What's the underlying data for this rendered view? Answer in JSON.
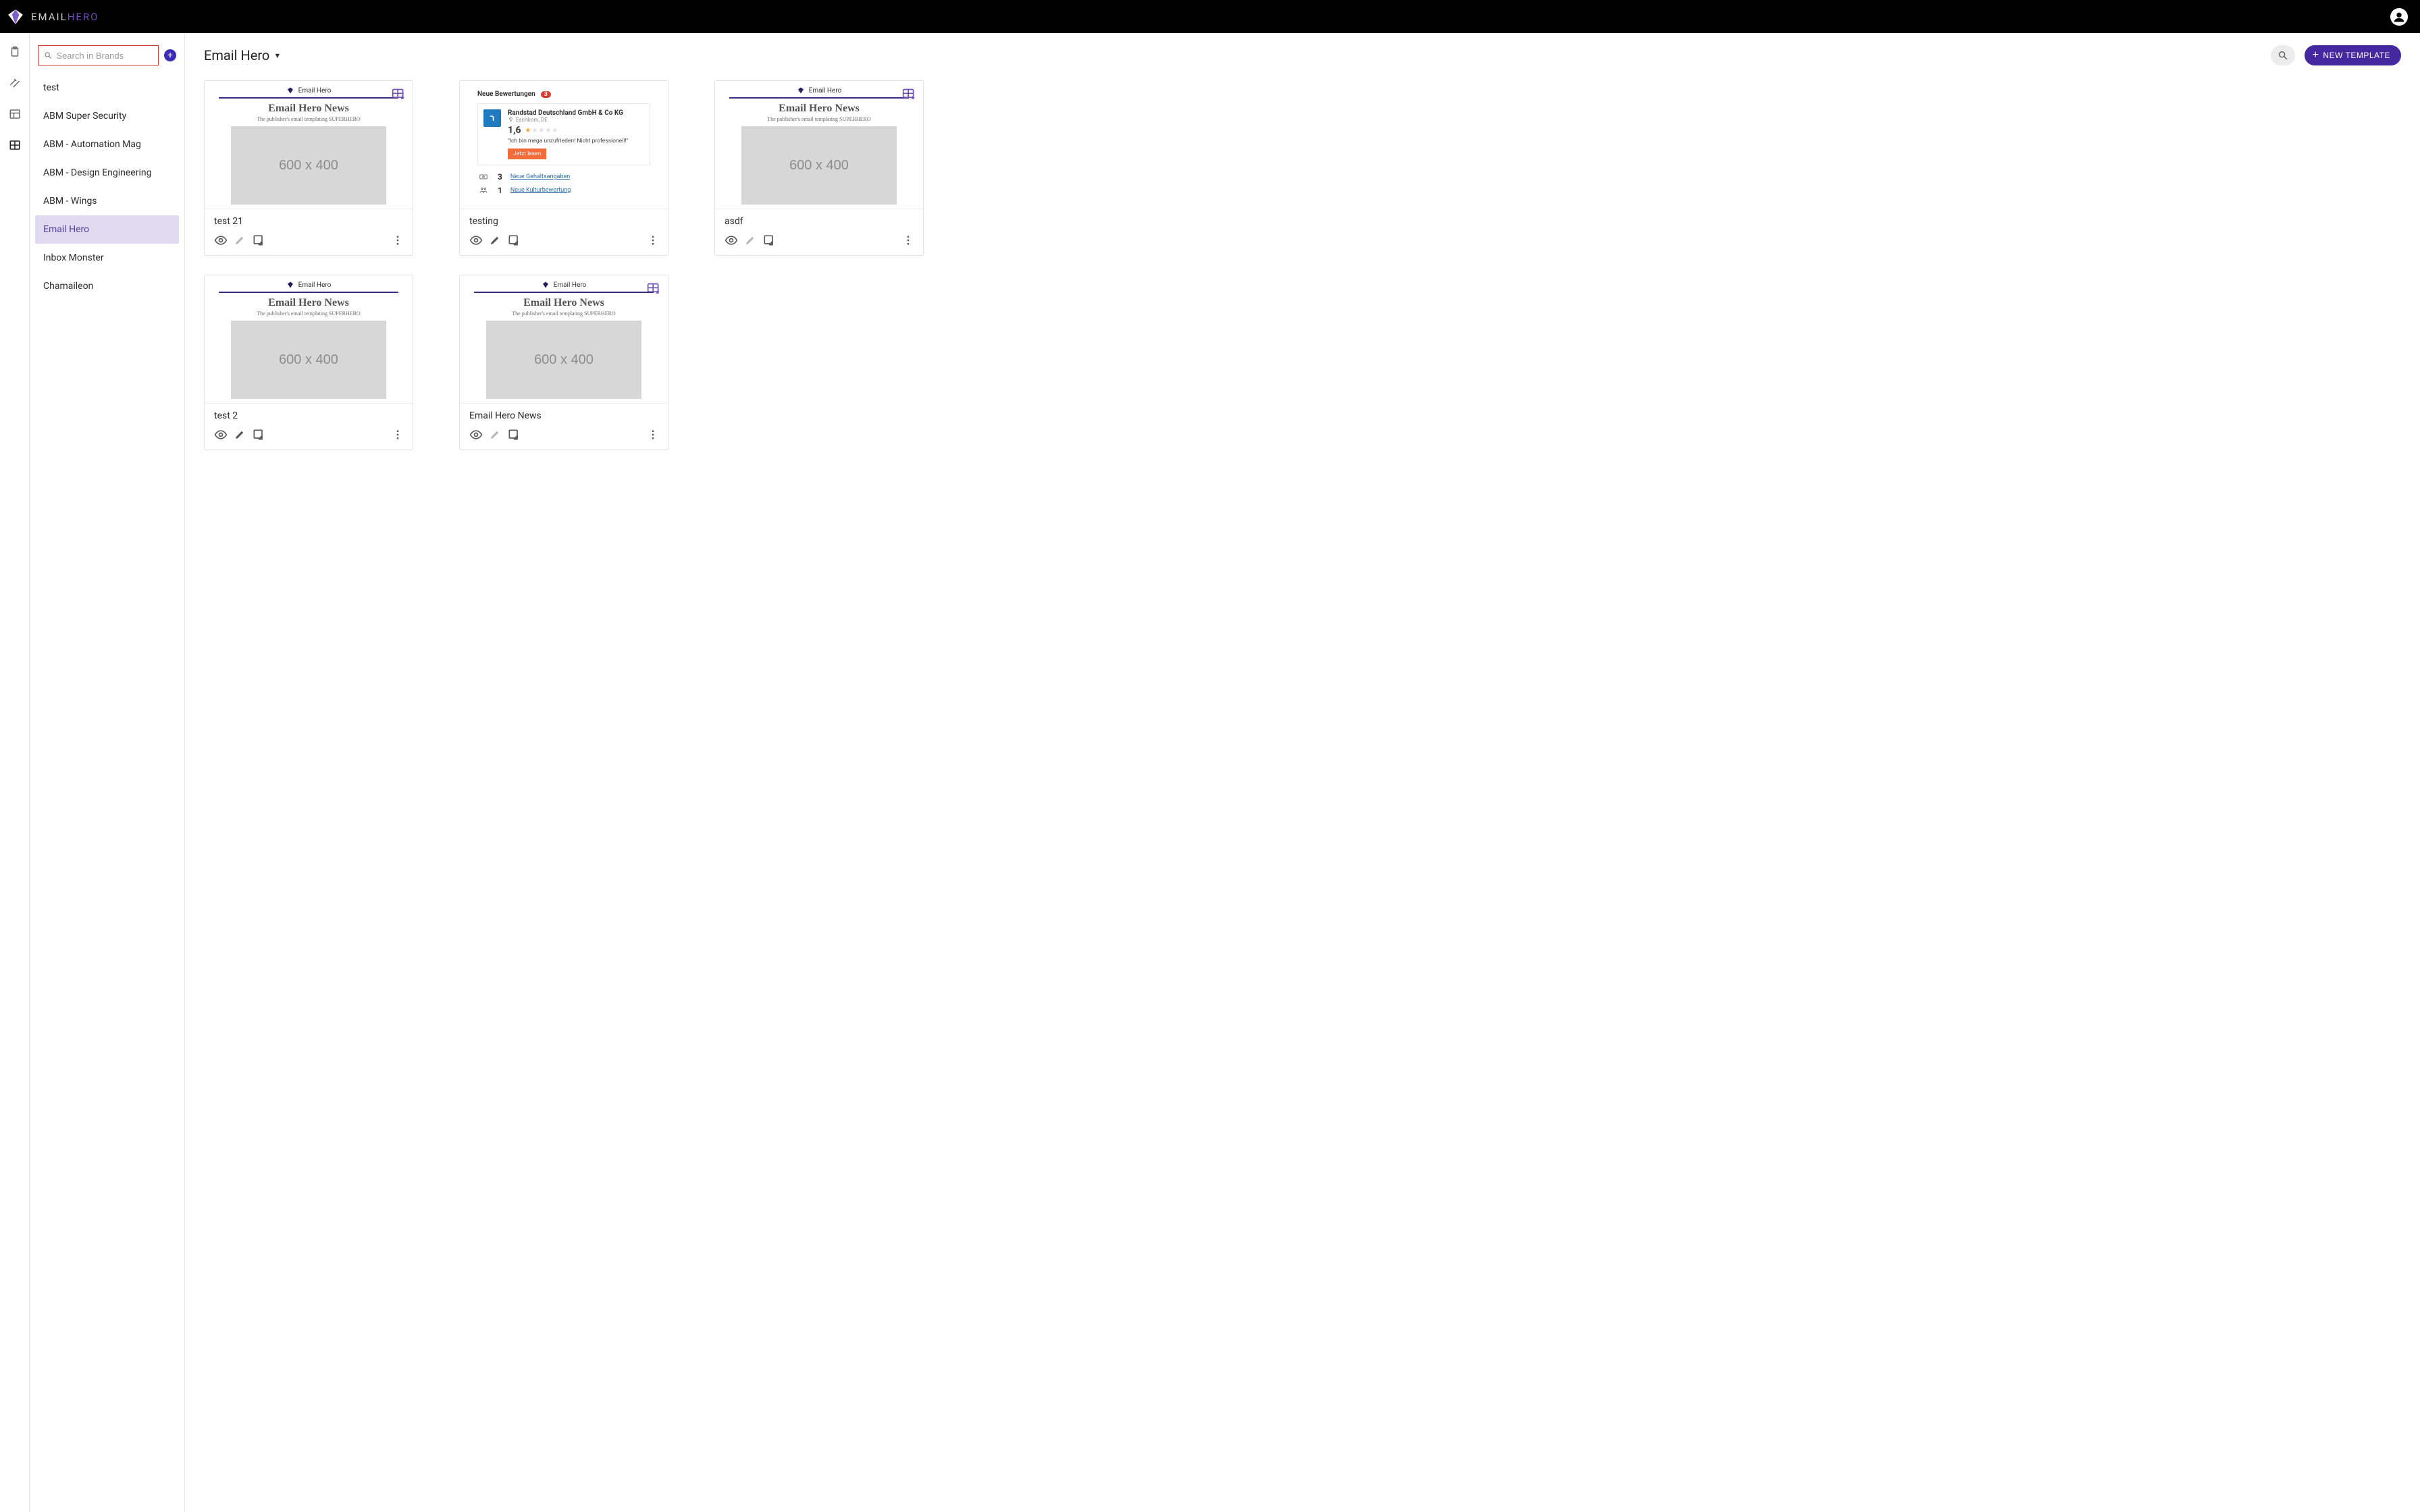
{
  "app": {
    "logo_text_a": "EMAIL",
    "logo_text_b": "HERO"
  },
  "rail": {
    "items": [
      {
        "name": "clipboard-icon"
      },
      {
        "name": "tools-icon"
      },
      {
        "name": "layout-icon"
      },
      {
        "name": "grid-icon"
      }
    ]
  },
  "sidebar": {
    "search_placeholder": "Search in Brands",
    "brands": [
      {
        "label": "test"
      },
      {
        "label": "ABM Super Security"
      },
      {
        "label": "ABM - Automation Mag"
      },
      {
        "label": "ABM - Design Engineering"
      },
      {
        "label": "ABM - Wings"
      },
      {
        "label": "Email Hero",
        "active": true
      },
      {
        "label": "Inbox Monster"
      },
      {
        "label": "Chamaileon"
      }
    ]
  },
  "header": {
    "title": "Email Hero",
    "new_button": "NEW TEMPLATE"
  },
  "preview_hero": {
    "brand_label": "Email Hero",
    "headline": "Email Hero News",
    "subline": "The publisher's email templating SUPERHERO",
    "placeholder": "600 x 400"
  },
  "preview_review": {
    "title": "Neue Bewertungen",
    "count": "3",
    "company": "Randstad Deutschland GmbH & Co KG",
    "location": "Eschborn, DE",
    "score": "1,6",
    "quote": "\"Ich bin mega unzufrieden! Nicht professionell!\"",
    "button": "Jetzt lesen",
    "stat1_n": "3",
    "stat1_label": "Neue Gehaltsangaben",
    "stat2_n": "1",
    "stat2_label": "Neue Kulturbewertung"
  },
  "cards": [
    {
      "title": "test 21",
      "preview": "hero",
      "badge": true,
      "preview_enabled": true,
      "edit_enabled": false,
      "copy_enabled": true
    },
    {
      "title": "testing",
      "preview": "review",
      "badge": false,
      "preview_enabled": true,
      "edit_enabled": true,
      "copy_enabled": true
    },
    {
      "title": "asdf",
      "preview": "hero",
      "badge": true,
      "preview_enabled": true,
      "edit_enabled": false,
      "copy_enabled": true
    },
    {
      "title": "test 2",
      "preview": "hero",
      "badge": false,
      "preview_enabled": true,
      "edit_enabled": true,
      "copy_enabled": true
    },
    {
      "title": "Email Hero News",
      "preview": "hero",
      "badge": true,
      "preview_enabled": true,
      "edit_enabled": false,
      "copy_enabled": true
    }
  ]
}
